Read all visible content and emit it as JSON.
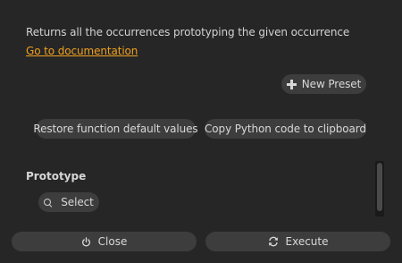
{
  "description": "Returns all the occurrences prototyping the given occurrence",
  "doc_link": "Go to documentation",
  "new_preset_label": "New Preset",
  "restore_label": "Restore function default values",
  "copy_label": "Copy Python code to clipboard",
  "section_title": "Prototype",
  "select_label": "Select",
  "close_label": "Close",
  "execute_label": "Execute",
  "colors": {
    "background": "#262626",
    "button": "#3d3d3d",
    "link": "#f0a020"
  }
}
